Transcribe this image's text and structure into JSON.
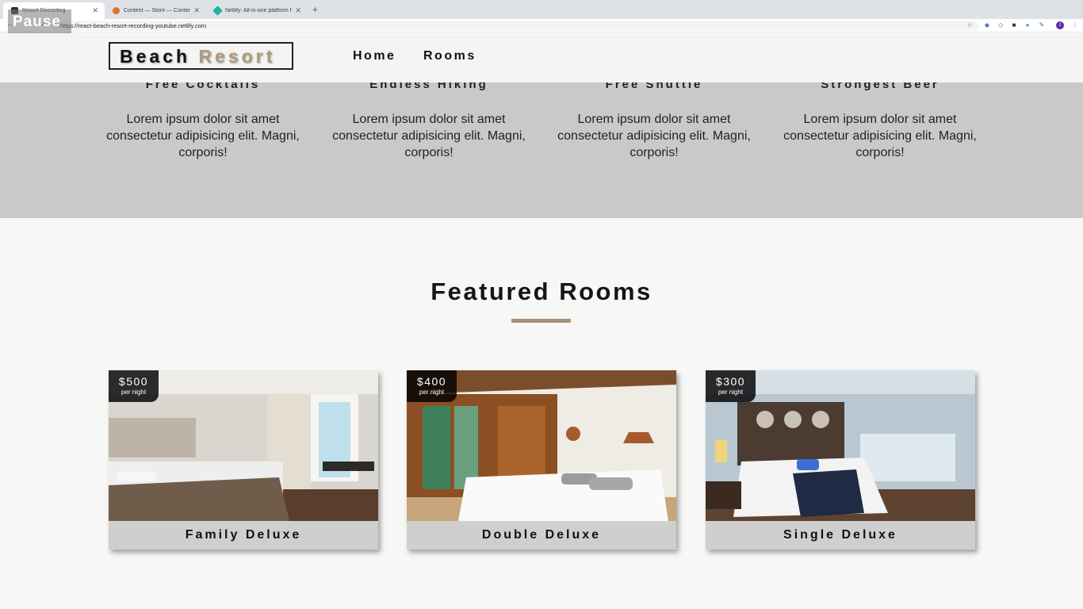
{
  "browser": {
    "tabs": [
      {
        "title": "Resort Recording",
        "active": true,
        "favicon_color": "#2b2b2b"
      },
      {
        "title": "Content — Store — Contentful",
        "active": false,
        "favicon_color": "#e46e34"
      },
      {
        "title": "Netlify: All-in-one platform for",
        "active": false,
        "favicon_color": "#25b3a3"
      }
    ],
    "url": "https://react-beach-resort-recording-youtube.netlify.com",
    "overlay": "Pause"
  },
  "navbar": {
    "logo_word1": "Beach",
    "logo_word2": "Resort",
    "links": [
      "Home",
      "Rooms"
    ]
  },
  "services": [
    {
      "title": "Free Cocktails",
      "text": "Lorem ipsum dolor sit amet consectetur adipisicing elit. Magni, corporis!"
    },
    {
      "title": "Endless Hiking",
      "text": "Lorem ipsum dolor sit amet consectetur adipisicing elit. Magni, corporis!"
    },
    {
      "title": "Free Shuttle",
      "text": "Lorem ipsum dolor sit amet consectetur adipisicing elit. Magni, corporis!"
    },
    {
      "title": "Strongest Beer",
      "text": "Lorem ipsum dolor sit amet consectetur adipisicing elit. Magni, corporis!"
    }
  ],
  "featured": {
    "title": "Featured Rooms",
    "rooms": [
      {
        "name": "Family Deluxe",
        "price": "$500",
        "unit": "per night"
      },
      {
        "name": "Double Deluxe",
        "price": "$400",
        "unit": "per night"
      },
      {
        "name": "Single Deluxe",
        "price": "$300",
        "unit": "per night"
      }
    ]
  },
  "colors": {
    "accent": "#af9a7d",
    "services_bg": "#c9c9c7",
    "navbar_bg": "#f4f4f2"
  }
}
